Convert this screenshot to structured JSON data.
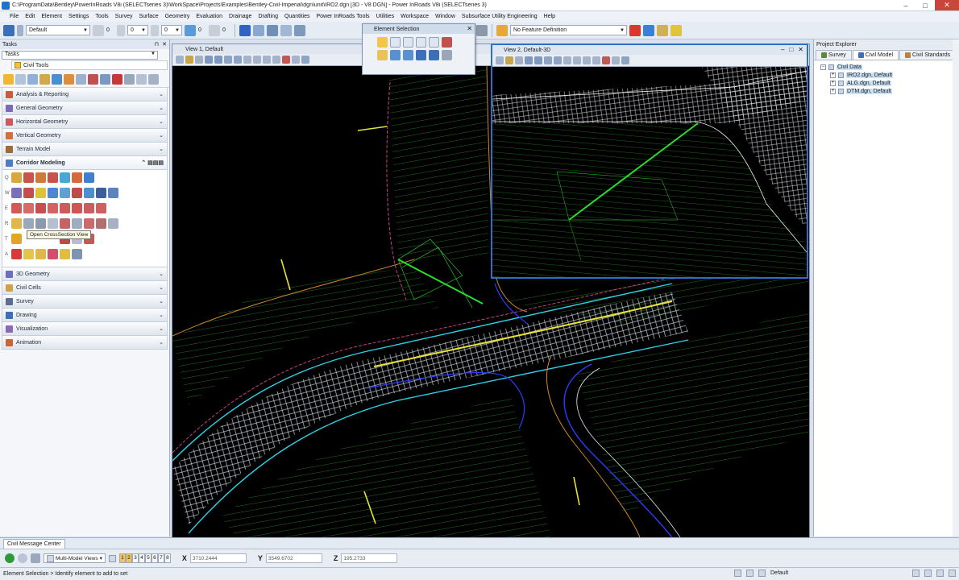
{
  "window": {
    "title": "C:\\ProgramData\\Bentley\\PowerInRoads V8i (SELECTseries 3)\\WorkSpace\\Projects\\Examples\\Bentley-Civil-Imperial\\dgn\\unit\\IRO2.dgn [3D - V8 DGN] - Power InRoads V8i (SELECTseries 3)",
    "minimize": "–",
    "maximize": "□",
    "close": "✕"
  },
  "menu": [
    "File",
    "Edit",
    "Element",
    "Settings",
    "Tools",
    "Survey",
    "Surface",
    "Geometry",
    "Evaluation",
    "Drainage",
    "Drafting",
    "Quantities",
    "Power InRoads Tools",
    "Utilities",
    "Workspace",
    "Window",
    "Subsurface Utility Engineering",
    "Help"
  ],
  "toolbar": {
    "level": "Default",
    "num1": "0",
    "num2": "0",
    "num3": "0",
    "num4": "0",
    "num5": "0",
    "feature_definition": "No Feature Definition"
  },
  "tasks": {
    "title": "Tasks",
    "combo": "Tasks",
    "civil_tools": "Civil Tools",
    "groups_top": [
      "Analysis & Reporting",
      "General Geometry",
      "Horizontal Geometry",
      "Vertical Geometry",
      "Terrain Model"
    ],
    "corridor": "Corridor Modeling",
    "row_letters": [
      "Q",
      "W",
      "E",
      "R",
      "T",
      "A"
    ],
    "tooltip": "Open CrossSection View",
    "groups_bottom": [
      "3D Geometry",
      "Civil Cells",
      "Survey",
      "Drawing",
      "Visualization",
      "Animation"
    ]
  },
  "element_selection": {
    "title": "Element Selection"
  },
  "view1": {
    "title": "View 1, Default"
  },
  "view2": {
    "title": "View 2, Default-3D"
  },
  "explorer": {
    "title": "Project Explorer",
    "tabs": [
      "Survey",
      "Civil Model",
      "Civil Standards"
    ],
    "root": "Civil Data",
    "children": [
      "IRO2.dgn, Default",
      "ALG.dgn, Default",
      "DTM.dgn, Default"
    ]
  },
  "message_center": {
    "tab": "Civil Message Center"
  },
  "status": {
    "views_dropdown": "Multi-Model Views",
    "view_numbers": [
      "1",
      "2",
      "3",
      "4",
      "5",
      "6",
      "7",
      "8"
    ],
    "x_label": "X",
    "x_value": "3710.2444",
    "y_label": "Y",
    "y_value": "3549.6702",
    "z_label": "Z",
    "z_value": "195.2733",
    "prompt": "Element Selection > Identify element to add to set",
    "level": "Default"
  },
  "colors": {
    "corridor_mesh": "#cfe3ff",
    "cyan_edge": "#2fd0e8",
    "blue_edge": "#2a3dff",
    "orange_edge": "#d08a2a",
    "yellow_line": "#e6e23a",
    "green_lines": "#1f7a1f",
    "bright_green": "#2bdc2b",
    "magenta": "#c7408a"
  }
}
